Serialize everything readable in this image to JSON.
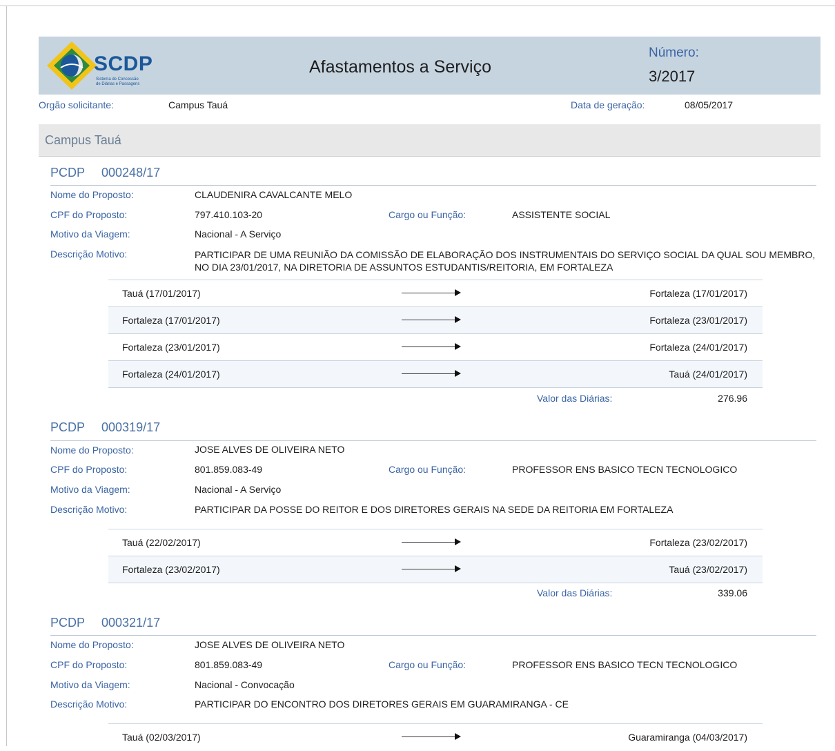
{
  "header": {
    "logo_text": "SCDP",
    "logo_sub1": "Sistema de Concessão",
    "logo_sub2": "de Diárias e Passagens",
    "title": "Afastamentos a Serviço",
    "numero_label": "Número:",
    "numero_value": "3/2017"
  },
  "meta": {
    "orgao_label": "Orgão solicitante:",
    "orgao_value": "Campus Tauá",
    "data_label": "Data de geração:",
    "data_value": "08/05/2017"
  },
  "section": {
    "title": "Campus Tauá"
  },
  "labels": {
    "pcdp": "PCDP",
    "nome": "Nome do Proposto:",
    "cpf": "CPF do Proposto:",
    "cargo": "Cargo ou Função:",
    "motivo": "Motivo da Viagem:",
    "descricao": "Descrição Motivo:",
    "valor_diarias": "Valor das Diárias:"
  },
  "pcdps": [
    {
      "numero": "000248/17",
      "nome": "CLAUDENIRA CAVALCANTE MELO",
      "cpf": "797.410.103-20",
      "cargo": "ASSISTENTE SOCIAL",
      "motivo": "Nacional - A Serviço",
      "descricao": "PARTICIPAR DE UMA REUNIÃO DA COMISSÃO DE ELABORAÇÃO DOS INSTRUMENTAIS DO SERVIÇO SOCIAL DA QUAL SOU MEMBRO, NO DIA 23/01/2017, NA DIRETORIA DE ASSUNTOS ESTUDANTIS/REITORIA, EM FORTALEZA",
      "trechos": [
        {
          "origem": "Tauá (17/01/2017)",
          "destino": "Fortaleza (17/01/2017)"
        },
        {
          "origem": "Fortaleza (17/01/2017)",
          "destino": "Fortaleza (23/01/2017)"
        },
        {
          "origem": "Fortaleza (23/01/2017)",
          "destino": "Fortaleza (24/01/2017)"
        },
        {
          "origem": "Fortaleza (24/01/2017)",
          "destino": "Tauá (24/01/2017)"
        }
      ],
      "valor_diarias": "276.96"
    },
    {
      "numero": "000319/17",
      "nome": "JOSE ALVES DE OLIVEIRA NETO",
      "cpf": "801.859.083-49",
      "cargo": "PROFESSOR ENS BASICO TECN TECNOLOGICO",
      "motivo": "Nacional - A Serviço",
      "descricao": "PARTICIPAR DA POSSE DO REITOR E DOS DIRETORES GERAIS NA SEDE DA REITORIA EM FORTALEZA",
      "trechos": [
        {
          "origem": "Tauá (22/02/2017)",
          "destino": "Fortaleza (23/02/2017)"
        },
        {
          "origem": "Fortaleza (23/02/2017)",
          "destino": "Tauá (23/02/2017)"
        }
      ],
      "valor_diarias": "339.06"
    },
    {
      "numero": "000321/17",
      "nome": "JOSE ALVES DE OLIVEIRA NETO",
      "cpf": "801.859.083-49",
      "cargo": "PROFESSOR ENS BASICO TECN TECNOLOGICO",
      "motivo": "Nacional - Convocação",
      "descricao": "PARTICIPAR DO ENCONTRO DOS DIRETORES GERAIS EM GUARAMIRANGA - CE",
      "trechos": [
        {
          "origem": "Tauá (02/03/2017)",
          "destino": "Guaramiranga (04/03/2017)"
        }
      ]
    }
  ]
}
